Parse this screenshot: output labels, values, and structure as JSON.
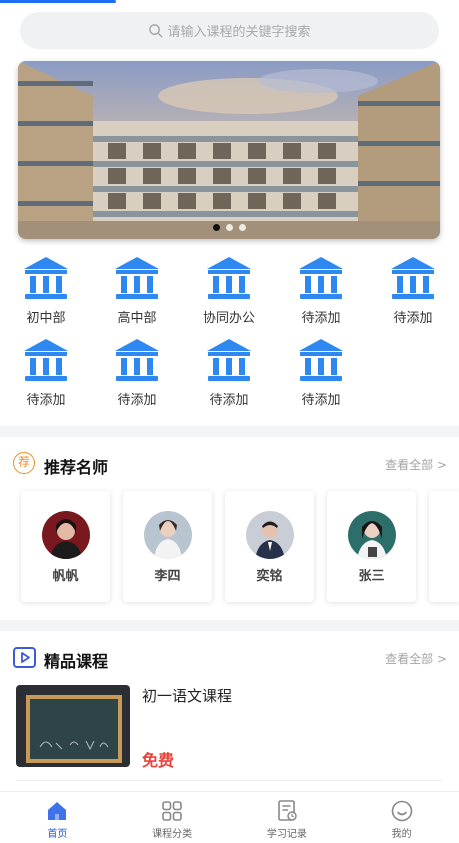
{
  "search": {
    "placeholder": "请输入课程的关键字搜索"
  },
  "banner": {
    "slide_count": 3,
    "active_index": 0
  },
  "categories": [
    {
      "label": "初中部",
      "icon": "bank-building-icon"
    },
    {
      "label": "高中部",
      "icon": "bank-building-icon"
    },
    {
      "label": "协同办公",
      "icon": "bank-building-icon"
    },
    {
      "label": "待添加",
      "icon": "bank-building-icon"
    },
    {
      "label": "待添加",
      "icon": "bank-building-icon"
    },
    {
      "label": "待添加",
      "icon": "bank-building-icon"
    },
    {
      "label": "待添加",
      "icon": "bank-building-icon"
    },
    {
      "label": "待添加",
      "icon": "bank-building-icon"
    },
    {
      "label": "待添加",
      "icon": "bank-building-icon"
    }
  ],
  "teachers_section": {
    "badge": "荐",
    "title": "推荐名师",
    "see_all": "查看全部 >",
    "teachers": [
      {
        "name": "帆帆"
      },
      {
        "name": "李四"
      },
      {
        "name": "奕铭"
      },
      {
        "name": "张三"
      }
    ]
  },
  "courses_section": {
    "title": "精品课程",
    "see_all": "查看全部 >",
    "courses": [
      {
        "title": "初一语文课程",
        "price": "免费"
      }
    ]
  },
  "tabbar": {
    "items": [
      {
        "label": "首页",
        "icon": "home-icon",
        "active": true
      },
      {
        "label": "课程分类",
        "icon": "grid-icon",
        "active": false
      },
      {
        "label": "学习记录",
        "icon": "record-icon",
        "active": false
      },
      {
        "label": "我的",
        "icon": "smiley-icon",
        "active": false
      }
    ]
  },
  "colors": {
    "accent": "#1e6ef4",
    "price": "#e8453c",
    "icon_blue": "#2f87f0"
  }
}
